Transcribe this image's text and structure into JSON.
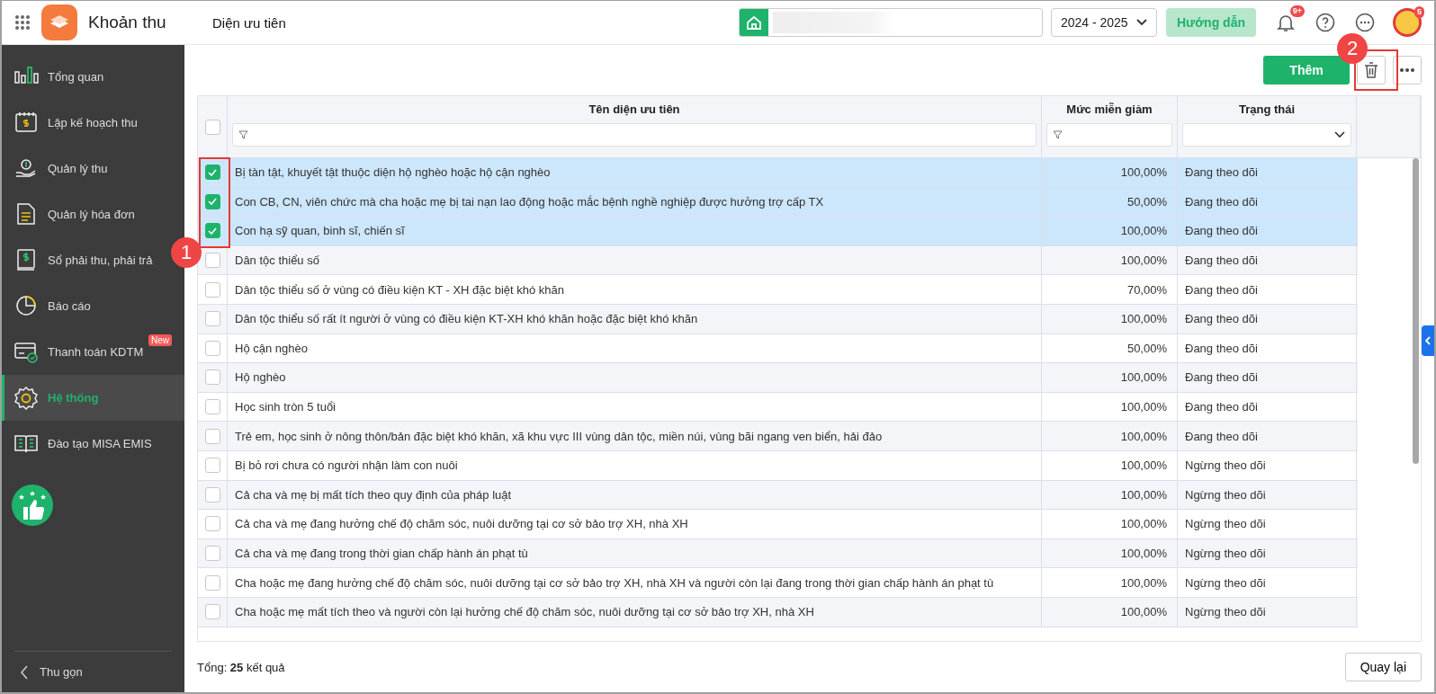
{
  "app": {
    "name": "Khoản thu",
    "page_title": "Diện ưu tiên"
  },
  "header": {
    "year_select": {
      "value": "2024 - 2025"
    },
    "guide_button": "Hướng dẫn",
    "notification_badge": "9+",
    "avatar_badge": "5"
  },
  "sidebar": {
    "items": [
      {
        "kind": "overview",
        "label": "Tổng quan",
        "selected": false
      },
      {
        "kind": "plan",
        "label": "Lập kế hoạch thu",
        "selected": false
      },
      {
        "kind": "collect",
        "label": "Quản lý thu",
        "selected": false
      },
      {
        "kind": "invoice",
        "label": "Quản lý hóa đơn",
        "selected": false
      },
      {
        "kind": "ledger",
        "label": "Sổ phải thu, phải trả",
        "selected": false
      },
      {
        "kind": "report",
        "label": "Báo cáo",
        "selected": false
      },
      {
        "kind": "payment",
        "label": "Thanh toán KDTM",
        "selected": false,
        "badge": "New"
      },
      {
        "kind": "system",
        "label": "Hệ thống",
        "selected": true
      },
      {
        "kind": "training",
        "label": "Đào tạo MISA EMIS",
        "selected": false
      }
    ],
    "collapse": "Thu gọn"
  },
  "toolbar": {
    "add_button": "Thêm"
  },
  "table": {
    "select_all_checked": false,
    "columns": [
      "Tên diện ưu tiên",
      "Mức miễn giảm",
      "Trạng thái"
    ],
    "rows": [
      {
        "name": "Bị tàn tật, khuyết tật thuộc diện hộ nghèo hoặc hộ cận nghèo",
        "rate": "100,00%",
        "status": "Đang theo dõi",
        "selected": true
      },
      {
        "name": "Con CB, CN, viên chức mà cha hoặc mẹ bị tai nạn lao động hoặc mắc bệnh nghề nghiệp được hưởng trợ cấp TX",
        "rate": "50,00%",
        "status": "Đang theo dõi",
        "selected": true
      },
      {
        "name": "Con hạ sỹ quan, binh sĩ, chiến sĩ",
        "rate": "100,00%",
        "status": "Đang theo dõi",
        "selected": true
      },
      {
        "name": "Dân tộc thiểu số",
        "rate": "100,00%",
        "status": "Đang theo dõi",
        "selected": false
      },
      {
        "name": "Dân tộc thiểu số ở vùng có điều kiện KT - XH đặc biệt khó khăn",
        "rate": "70,00%",
        "status": "Đang theo dõi",
        "selected": false
      },
      {
        "name": "Dân tộc thiểu số rất ít người ở vùng có điều kiện KT-XH khó khăn hoặc đặc biệt khó khăn",
        "rate": "100,00%",
        "status": "Đang theo dõi",
        "selected": false
      },
      {
        "name": "Hộ cận nghèo",
        "rate": "50,00%",
        "status": "Đang theo dõi",
        "selected": false
      },
      {
        "name": "Hộ nghèo",
        "rate": "100,00%",
        "status": "Đang theo dõi",
        "selected": false
      },
      {
        "name": "Học sinh tròn 5 tuổi",
        "rate": "100,00%",
        "status": "Đang theo dõi",
        "selected": false
      },
      {
        "name": "Trẻ em, học sinh ở nông thôn/bản đặc biệt khó khăn, xã khu vực III vùng dân tộc, miền núi, vùng bãi ngang ven biển, hải đảo",
        "rate": "100,00%",
        "status": "Đang theo dõi",
        "selected": false
      },
      {
        "name": "Bị bỏ rơi chưa có người nhận làm con nuôi",
        "rate": "100,00%",
        "status": "Ngừng theo dõi",
        "selected": false
      },
      {
        "name": "Cả cha và mẹ bị mất tích theo quy định của pháp luật",
        "rate": "100,00%",
        "status": "Ngừng theo dõi",
        "selected": false
      },
      {
        "name": "Cả cha và mẹ đang hưởng chế độ chăm sóc, nuôi dưỡng tại cơ sở bảo trợ XH, nhà XH",
        "rate": "100,00%",
        "status": "Ngừng theo dõi",
        "selected": false
      },
      {
        "name": "Cả cha và mẹ đang trong thời gian chấp hành án phạt tù",
        "rate": "100,00%",
        "status": "Ngừng theo dõi",
        "selected": false
      },
      {
        "name": "Cha hoặc mẹ đang hưởng chế độ chăm sóc, nuôi dưỡng tại cơ sở bảo trợ XH, nhà XH và người còn lại đang trong thời gian chấp hành án phạt tù",
        "rate": "100,00%",
        "status": "Ngừng theo dõi",
        "selected": false
      },
      {
        "name": "Cha hoặc mẹ mất tích theo và người còn lại hưởng chế độ chăm sóc, nuôi dưỡng tại cơ sở bảo trợ XH, nhà XH",
        "rate": "100,00%",
        "status": "Ngừng theo dõi",
        "selected": false
      }
    ]
  },
  "footer": {
    "total": "Tổng: **25** kết quả",
    "back_button": "Quay lại"
  },
  "callouts": [
    {
      "kind": "checkboxes",
      "label": "1"
    },
    {
      "kind": "delete",
      "label": "2"
    }
  ]
}
